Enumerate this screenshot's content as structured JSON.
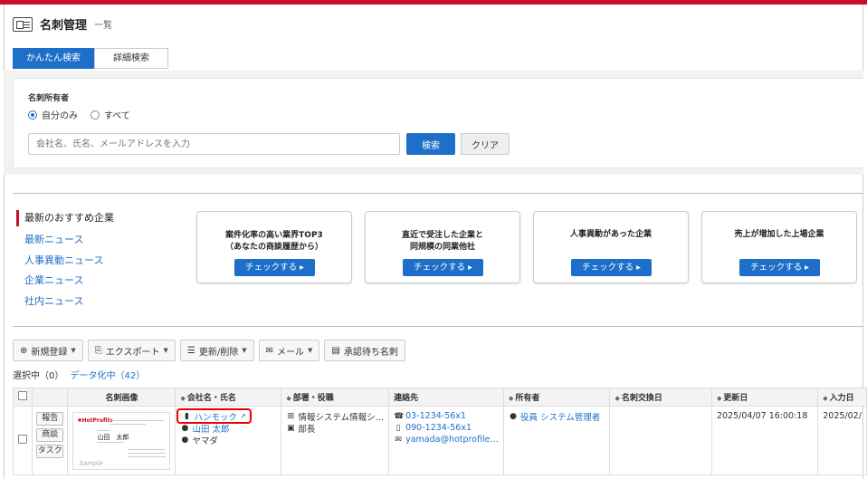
{
  "header": {
    "title": "名刺管理",
    "subtitle": "一覧"
  },
  "search_tabs": [
    "かんたん検索",
    "詳細検索"
  ],
  "search": {
    "owner_label": "名刺所有者",
    "owner_options": [
      "自分のみ",
      "すべて"
    ],
    "selected_owner": "自分のみ",
    "placeholder": "会社名、氏名、メールアドレスを入力",
    "search_button": "検索",
    "clear_button": "クリア"
  },
  "news_nav": [
    "最新のおすすめ企業",
    "最新ニュース",
    "人事異動ニュース",
    "企業ニュース",
    "社内ニュース"
  ],
  "cards": [
    {
      "title_line1": "案件化率の高い業界TOP3",
      "title_line2": "（あなたの商談履歴から）",
      "button": "チェックする ▸"
    },
    {
      "title_line1": "直近で受注した企業と",
      "title_line2": "同規模の同業他社",
      "button": "チェックする ▸"
    },
    {
      "title_line1": "人事異動があった企業",
      "title_line2": "",
      "button": "チェックする ▸"
    },
    {
      "title_line1": "売上が増加した上場企業",
      "title_line2": "",
      "button": "チェックする ▸"
    }
  ],
  "toolbar": {
    "new": "新規登録",
    "export": "エクスポート",
    "update": "更新/削除",
    "mail": "メール",
    "pending": "承認待ち名刺"
  },
  "selection": {
    "selected": "選択中（0）",
    "digitized": "データ化中（42）"
  },
  "table": {
    "columns": [
      "名刺画像",
      "会社名・氏名",
      "部署・役職",
      "連絡先",
      "所有者",
      "名刺交換日",
      "更新日",
      "入力日"
    ],
    "row": {
      "actions": [
        "報告",
        "商談",
        "タスク"
      ],
      "card_image": {
        "logo": "✱HotProfile",
        "name": "山田　太郎",
        "watermark": "Sample"
      },
      "company": "ハンモック",
      "name": "山田 太郎",
      "kana": "ヤマダ",
      "department": "情報システム情報シ…",
      "title": "部長",
      "phone": "03-1234-56x1",
      "mobile": "090-1234-56x1",
      "email": "yamada@hotprofile…",
      "owner": "役員 システム管理者",
      "exchange_date": "",
      "updated": "2025/04/07 16:00:18",
      "entered": "2025/02/"
    }
  }
}
